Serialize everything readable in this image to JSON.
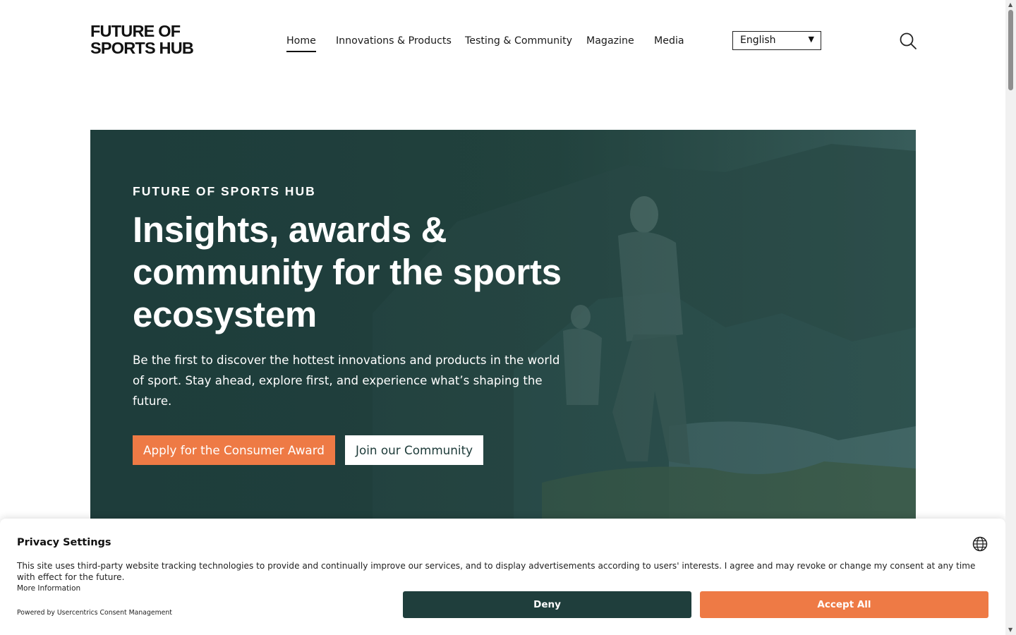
{
  "header": {
    "logo_line1": "FUTURE OF",
    "logo_line2": "SPORTS HUB",
    "nav": [
      {
        "label": "Home",
        "active": true
      },
      {
        "label": "Innovations & Products",
        "active": false
      },
      {
        "label": "Testing & Community",
        "active": false
      },
      {
        "label": "Magazine",
        "active": false
      },
      {
        "label": "Media",
        "active": false
      }
    ],
    "language": "English",
    "search_icon": "search-icon"
  },
  "hero": {
    "eyebrow": "FUTURE OF SPORTS HUB",
    "title": "Insights, awards & community for the sports ecosystem",
    "text": "Be the first to discover the hottest innovations and products in the world of sport. Stay ahead, explore first, and experience what’s shaping the future.",
    "primary_button": "Apply for the Consumer Award",
    "secondary_button": "Join our Community",
    "background_color": "#21403e",
    "accent_color": "#ee7a45"
  },
  "cookie_banner": {
    "title": "Privacy Settings",
    "text": "This site uses third-party website tracking technologies to provide and continually improve our services, and to display advertisements according to users' interests. I agree and may revoke or change my consent at any time with effect for the future.",
    "more_info": "More Information",
    "powered_by": "Powered by Usercentrics Consent Management",
    "deny_label": "Deny",
    "accept_label": "Accept All",
    "globe_icon": "globe-icon",
    "deny_color": "#1f3e3c",
    "accept_color": "#ee7a45"
  }
}
